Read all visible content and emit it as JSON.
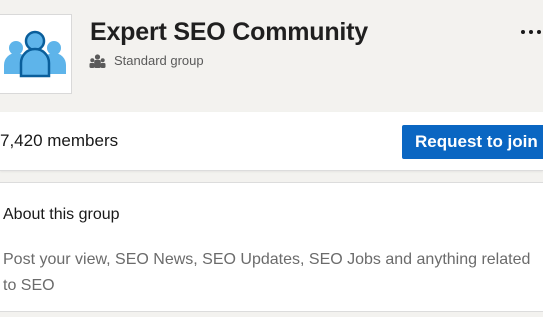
{
  "group": {
    "name": "Expert SEO Community",
    "type": "Standard group",
    "logo_icon": "group-people-icon",
    "type_icon": "people-icon",
    "more_icon": "more-options-icon"
  },
  "members": {
    "count_label": "7,420 members"
  },
  "actions": {
    "join_label": "Request to join"
  },
  "about": {
    "title": "About this group",
    "description": "Post your view, SEO News, SEO Updates, SEO Jobs and anything related to SEO"
  },
  "colors": {
    "primary_button": "#0a66c2",
    "logo_accent": "#5eb4ea",
    "logo_dark": "#0a5e9b"
  }
}
